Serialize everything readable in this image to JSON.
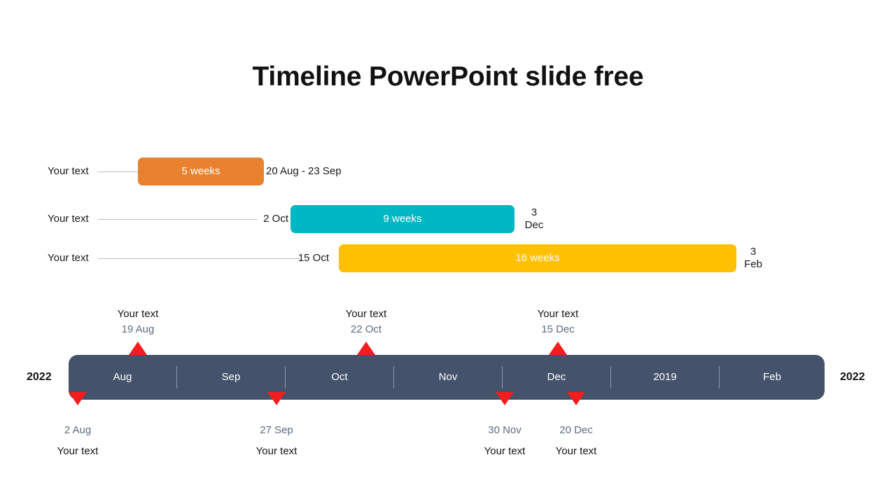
{
  "slide": {
    "title": "Timeline PowerPoint slide free",
    "background": "#FFFFFF"
  },
  "colors": {
    "bar_orange": "#E8822E",
    "bar_teal": "#00B8C4",
    "bar_yellow": "#FFC000",
    "axis_slate": "#44536B",
    "marker_red": "#F31D1D",
    "date_text": "#5C6B82",
    "connector": "#B9BCC2"
  },
  "gantt": {
    "rows": [
      {
        "label": "Your text",
        "start_date": "",
        "bar_text": "5 weeks",
        "end_date": "20 Aug - 23 Sep",
        "color": "#E8822E"
      },
      {
        "label": "Your text",
        "start_date": "2 Oct",
        "bar_text": "9 weeks",
        "end_date_line1": "3",
        "end_date_line2": "Dec",
        "color": "#00B8C4"
      },
      {
        "label": "Your text",
        "start_date": "15 Oct",
        "bar_text": "16 weeks",
        "end_date_line1": "3",
        "end_date_line2": "Feb",
        "color": "#FFC000"
      }
    ]
  },
  "axis": {
    "year_left": "2022",
    "year_right": "2022",
    "segments": [
      {
        "label": "Aug"
      },
      {
        "label": "Sep"
      },
      {
        "label": "Oct"
      },
      {
        "label": "Nov"
      },
      {
        "label": "Dec"
      },
      {
        "label": "2019"
      },
      {
        "label": "Feb"
      }
    ]
  },
  "markers": {
    "above": [
      {
        "title": "Your text",
        "date": "19 Aug"
      },
      {
        "title": "Your text",
        "date": "22 Oct"
      },
      {
        "title": "Your text",
        "date": "15 Dec"
      }
    ],
    "below": [
      {
        "date": "2 Aug",
        "title": "Your text"
      },
      {
        "date": "27 Sep",
        "title": "Your text"
      },
      {
        "date": "30 Nov",
        "title": "Your text"
      },
      {
        "date": "20 Dec",
        "title": "Your text"
      }
    ]
  }
}
